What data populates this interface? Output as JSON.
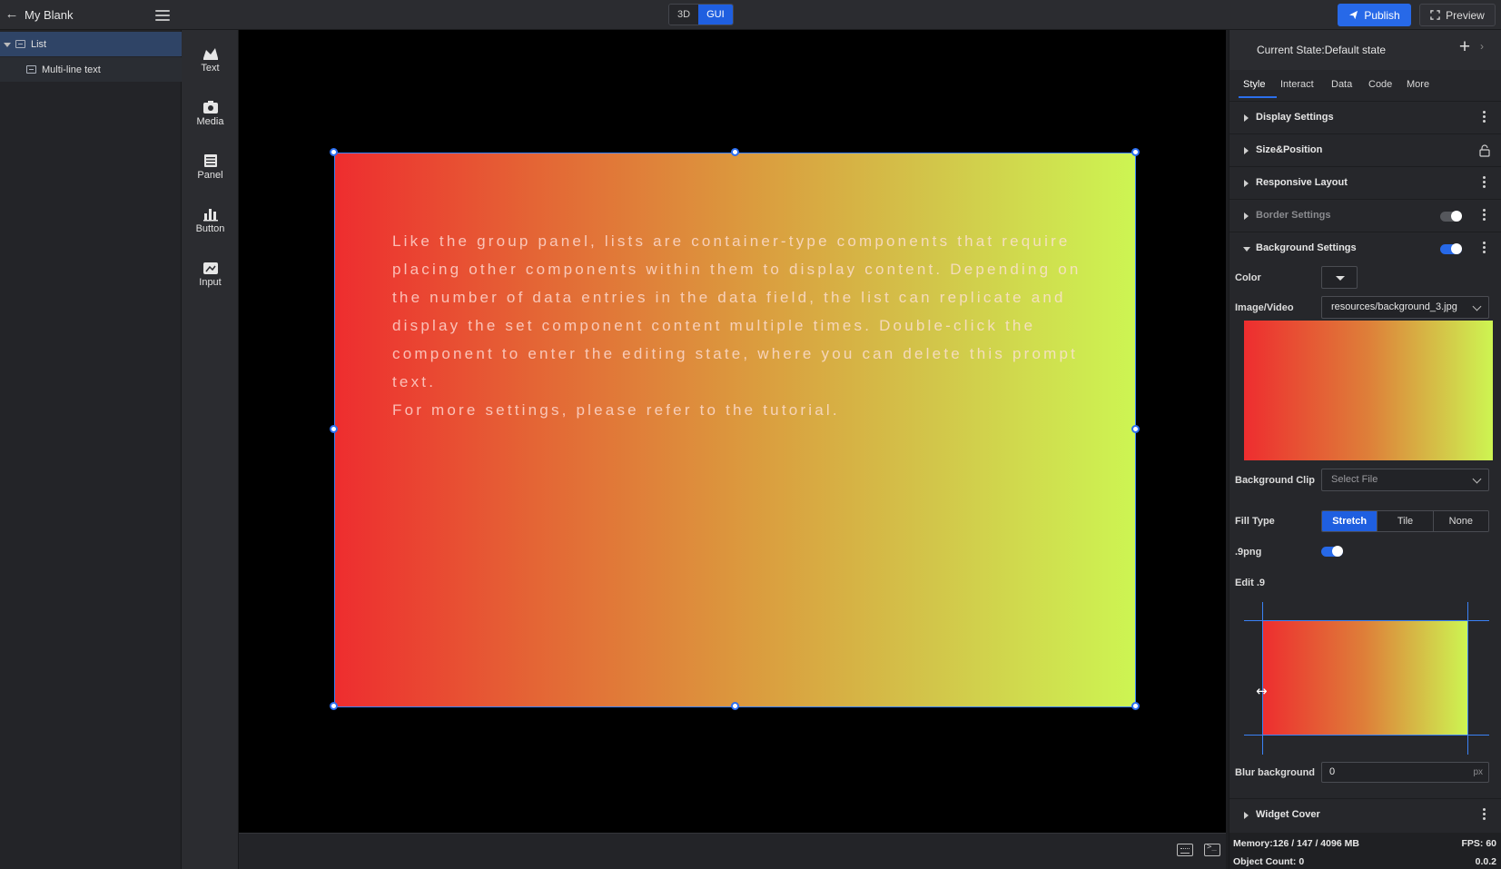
{
  "topbar": {
    "project_title": "My Blank",
    "mode_3d": "3D",
    "mode_gui": "GUI",
    "publish_label": "Publish",
    "preview_label": "Preview"
  },
  "tree": {
    "items": [
      {
        "label": "List",
        "selected": true
      },
      {
        "label": "Multi-line text",
        "selected": false
      }
    ]
  },
  "components": [
    {
      "label": "Text",
      "icon": "text-icon"
    },
    {
      "label": "Media",
      "icon": "media-icon"
    },
    {
      "label": "Panel",
      "icon": "panel-icon"
    },
    {
      "label": "Button",
      "icon": "button-icon"
    },
    {
      "label": "Input",
      "icon": "input-icon"
    }
  ],
  "canvas": {
    "widget_text": "Like the group panel, lists are container-type components that require placing other components within them to display content. Depending on the number of data entries in the data field, the list can replicate and display the set component content multiple times. Double-click the component to enter the editing state, where you can delete this prompt text.\nFor more settings, please refer to the tutorial."
  },
  "panel": {
    "current_state": "Current State:Default state",
    "tabs": [
      "Style",
      "Interact",
      "Data",
      "Code",
      "More"
    ],
    "active_tab": "Style",
    "sections": {
      "display": "Display Settings",
      "size_position": "Size&Position",
      "responsive": "Responsive Layout",
      "border": "Border Settings",
      "background": "Background Settings",
      "widget_cover": "Widget Cover"
    },
    "background": {
      "color_label": "Color",
      "image_label": "Image/Video",
      "image_value": "resources/background_3.jpg",
      "clip_label": "Background Clip",
      "clip_placeholder": "Select File",
      "fill_type_label": "Fill Type",
      "fill_options": [
        "Stretch",
        "Tile",
        "None"
      ],
      "fill_selected": "Stretch",
      "nine_png_label": ".9png",
      "nine_png_on": true,
      "edit9_label": "Edit .9",
      "blur_label": "Blur background",
      "blur_value": "0",
      "blur_unit": "px",
      "enabled": true
    },
    "border_enabled": false
  },
  "status": {
    "memory": "Memory:126 / 147 / 4096 MB",
    "fps": "FPS: 60",
    "object_count": "Object Count: 0",
    "version": "0.0.2"
  },
  "colors": {
    "accent": "#2769e8",
    "gradient_start": "#ee2d2f",
    "gradient_end": "#cdf552",
    "selection": "#3b82f6"
  }
}
